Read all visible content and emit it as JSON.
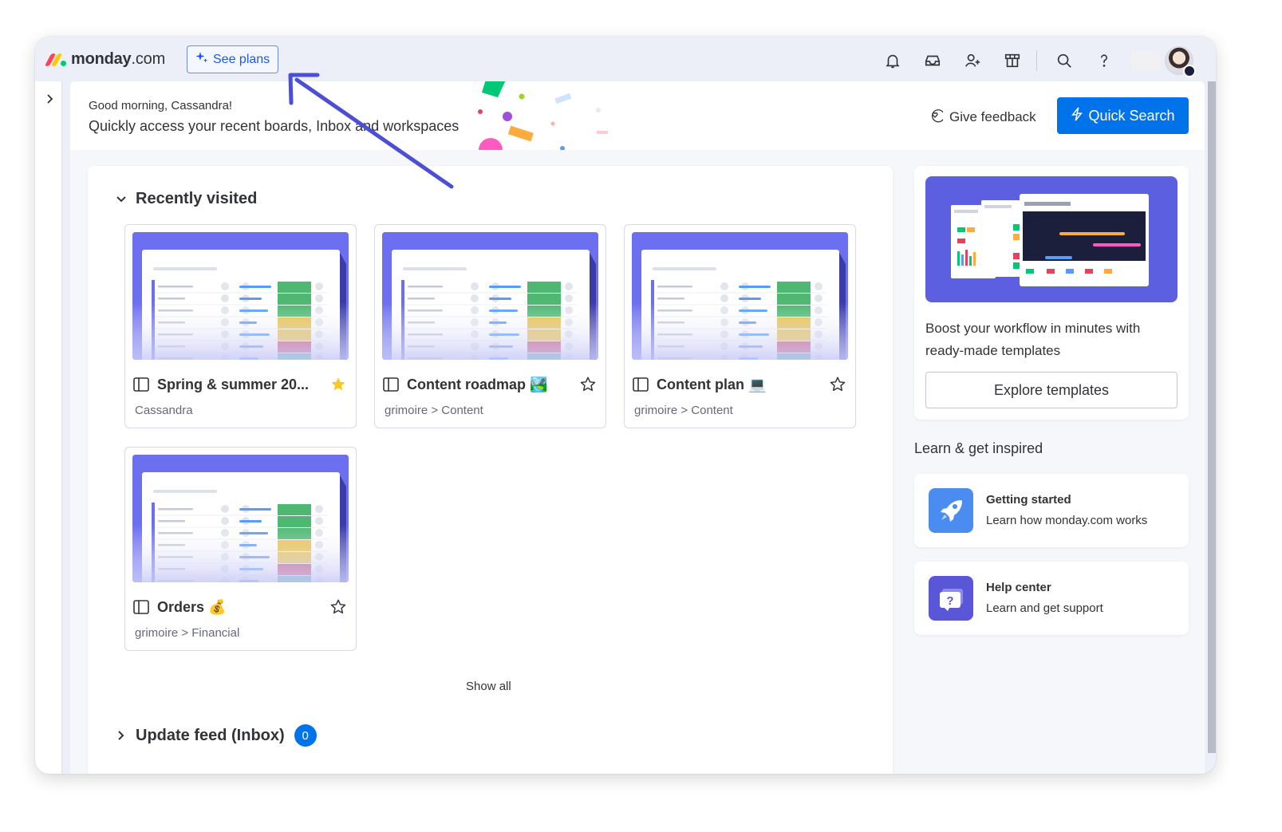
{
  "app": {
    "logo_brand": "monday",
    "logo_suffix": ".com",
    "see_plans_label": "See plans"
  },
  "header_icons": [
    "bell-icon",
    "inbox-icon",
    "invite-members-icon",
    "marketplace-icon",
    "search-icon",
    "help-icon"
  ],
  "greeting": {
    "small": "Good morning, Cassandra!",
    "big": "Quickly access your recent boards, Inbox and workspaces",
    "feedback_label": "Give feedback",
    "quick_search_label": "Quick Search"
  },
  "recently_visited": {
    "title": "Recently visited",
    "boards": [
      {
        "name": "Spring & summer 20...",
        "path": "Cassandra",
        "starred": true
      },
      {
        "name": "Content roadmap 🏞️",
        "path": "grimoire > Content",
        "starred": false
      },
      {
        "name": "Content plan 💻",
        "path": "grimoire > Content",
        "starred": false
      },
      {
        "name": "Orders 💰",
        "path": "grimoire > Financial",
        "starred": false
      }
    ],
    "show_all_label": "Show all"
  },
  "update_feed": {
    "title": "Update feed (Inbox)",
    "count": "0"
  },
  "templates_promo": {
    "text": "Boost your workflow in minutes with ready-made templates",
    "button_label": "Explore templates"
  },
  "learn": {
    "title": "Learn & get inspired",
    "items": [
      {
        "title": "Getting started",
        "subtitle": "Learn how monday.com works",
        "icon": "rocket-icon"
      },
      {
        "title": "Help center",
        "subtitle": "Learn and get support",
        "icon": "help-chat-icon"
      }
    ]
  },
  "colors": {
    "primary": "#0073ea",
    "board_thumb": "#6c6ff0",
    "status_green": "#4eb872",
    "status_yellow": "#e8c048",
    "status_pink": "#c8406e",
    "status_teal": "#40a598",
    "star_gold": "#f8c822",
    "annotation_arrow": "#4b4fd6"
  }
}
